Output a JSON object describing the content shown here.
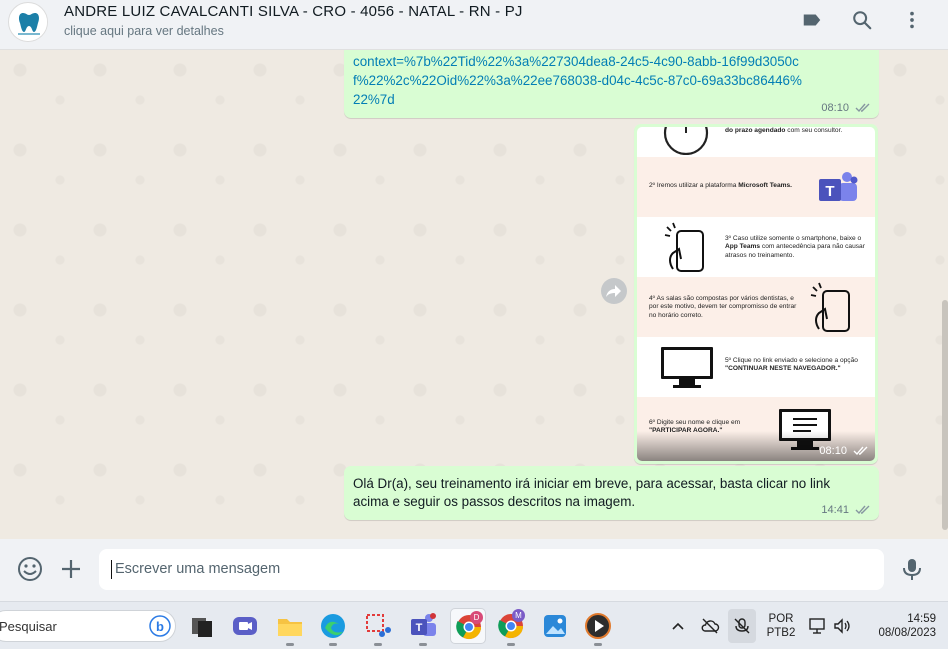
{
  "header": {
    "title": "ANDRE LUIZ CAVALCANTI SILVA - CRO - 4056 - NATAL - RN - PJ",
    "subtitle": "clique aqui para ver detalhes",
    "icons": [
      "label-icon",
      "search-icon",
      "menu-dots-icon"
    ]
  },
  "messages": [
    {
      "type": "text",
      "link": "context=%7b%22Tid%22%3a%227304dea8-24c5-4c90-8abb-16f99d3050cf%22%2c%22Oid%22%3a%22ee768038-d04c-4c5c-87c0-69a33bc86446%22%7d",
      "time": "08:10"
    },
    {
      "type": "image",
      "time": "08:10",
      "steps": [
        {
          "prefix": "",
          "bold": "do prazo agendado",
          "suffix": " com seu consultor."
        },
        {
          "prefix": "2º Iremos utilizar a plataforma ",
          "bold": "Microsoft Teams.",
          "suffix": ""
        },
        {
          "prefix": "3º Caso utilize somente o smartphone, baixe o ",
          "bold": "App Teams",
          "suffix": " com antecedência para não causar atrasos no treinamento."
        },
        {
          "prefix": "4º As salas são compostas por vários dentistas, e por este motivo, devem ter compromisso de entrar no horário correto.",
          "bold": "",
          "suffix": ""
        },
        {
          "prefix": "5º Clique no link enviado e selecione a opção ",
          "bold": "\"CONTINUAR NESTE NAVEGADOR.\"",
          "suffix": ""
        },
        {
          "prefix": "6º Digite seu nome e clique em ",
          "bold": "\"PARTICIPAR AGORA.\"",
          "suffix": ""
        }
      ]
    },
    {
      "type": "text",
      "text": "Olá Dr(a), seu treinamento irá iniciar em breve, para acessar, basta clicar no link acima e seguir os passos descritos na imagem.",
      "time": "14:41"
    }
  ],
  "composer": {
    "placeholder": "Escrever uma mensagem"
  },
  "taskbar": {
    "search_label": "Pesquisar",
    "language_line1": "POR",
    "language_line2": "PTB2",
    "time": "14:59",
    "date": "08/08/2023",
    "chrome_badge_1": "D",
    "chrome_badge_2": "M"
  },
  "colors": {
    "bubble_out": "#d9fdd3",
    "link": "#027eb5",
    "chat_bg": "#efeae2",
    "header_bg": "#f0f2f5"
  }
}
